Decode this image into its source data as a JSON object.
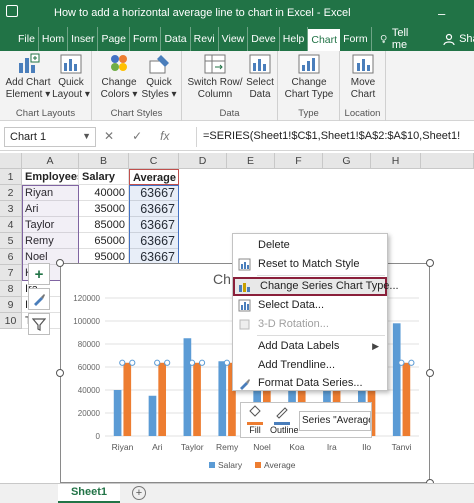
{
  "window": {
    "title": "How to add a horizontal average line to chart in Excel  -  Excel",
    "minimize_glyph": "–"
  },
  "tabs": [
    {
      "label": "File"
    },
    {
      "label": "Hom"
    },
    {
      "label": "Inser"
    },
    {
      "label": "Page"
    },
    {
      "label": "Form"
    },
    {
      "label": "Data"
    },
    {
      "label": "Revi"
    },
    {
      "label": "View"
    },
    {
      "label": "Deve"
    },
    {
      "label": "Help"
    },
    {
      "label": "Chart"
    },
    {
      "label": "Form"
    }
  ],
  "tell_me": "Tell me",
  "share": "Share",
  "ribbon": {
    "groups": {
      "chart_layouts": "Chart Layouts",
      "chart_styles": "Chart Styles",
      "data": "Data",
      "type": "Type",
      "location": "Location"
    },
    "buttons": {
      "add_chart_element_1": "Add Chart",
      "add_chart_element_2": "Element ▾",
      "quick_layout_1": "Quick",
      "quick_layout_2": "Layout ▾",
      "change_colors_1": "Change",
      "change_colors_2": "Colors ▾",
      "quick_styles_1": "Quick",
      "quick_styles_2": "Styles ▾",
      "switch_rowcol_1": "Switch Row/",
      "switch_rowcol_2": "Column",
      "select_data_1": "Select",
      "select_data_2": "Data",
      "change_type_1": "Change",
      "change_type_2": "Chart Type",
      "move_chart_1": "Move",
      "move_chart_2": "Chart"
    }
  },
  "name_box": "Chart 1",
  "formula": "=SERIES(Sheet1!$C$1,Sheet1!$A$2:$A$10,Sheet1!",
  "formula_buttons": {
    "cancel": "✕",
    "enter": "✓",
    "fx": "fx"
  },
  "columns": [
    "A",
    "B",
    "C",
    "D",
    "E",
    "F",
    "G",
    "H"
  ],
  "rows": [
    "1",
    "2",
    "3",
    "4",
    "5",
    "6",
    "7",
    "8",
    "9",
    "10"
  ],
  "table": {
    "headers": [
      "Employees",
      "Salary",
      "Average"
    ],
    "data": [
      [
        "Riyan",
        "40000",
        "63667"
      ],
      [
        "Ari",
        "35000",
        "63667"
      ],
      [
        "Taylor",
        "85000",
        "63667"
      ],
      [
        "Remy",
        "65000",
        "63667"
      ],
      [
        "Noel",
        "95000",
        "63667"
      ],
      [
        "K",
        "",
        ""
      ],
      [
        "Ira",
        "",
        ""
      ],
      [
        "Ilo",
        "",
        ""
      ],
      [
        "Tanvi",
        "",
        ""
      ]
    ]
  },
  "chart_data": {
    "type": "bar",
    "title": "Ch",
    "categories": [
      "Riyan",
      "Ari",
      "Taylor",
      "Remy",
      "Noel",
      "Koa",
      "Ira",
      "Ilo",
      "Tanvi"
    ],
    "category_labels_visible": [
      "Riyan",
      "Ari",
      "Taylor",
      "Remy",
      "Noel",
      "Koa",
      "Ira",
      "Ilo",
      "Tanvi"
    ],
    "series": [
      {
        "name": "Salary",
        "color": "#5B9BD5",
        "values": [
          40000,
          35000,
          85000,
          65000,
          95000,
          75000,
          50000,
          60000,
          98000
        ]
      },
      {
        "name": "Average",
        "color": "#ED7D31",
        "values": [
          63667,
          63667,
          63667,
          63667,
          63667,
          63667,
          63667,
          63667,
          63667
        ]
      }
    ],
    "ylim": [
      0,
      120000
    ],
    "yticks": [
      "0",
      "20000",
      "40000",
      "60000",
      "80000",
      "100000",
      "120000"
    ],
    "legend": "bottom",
    "grid": true
  },
  "context_menu": {
    "items": [
      {
        "label": "Delete",
        "icon": "none",
        "disabled": false
      },
      {
        "label": "Reset to Match Style",
        "icon": "reset-icon",
        "disabled": false
      },
      {
        "label": "Change Series Chart Type...",
        "icon": "chart-type-icon",
        "disabled": false,
        "highlighted": true
      },
      {
        "label": "Select Data...",
        "icon": "select-data-icon",
        "disabled": false
      },
      {
        "label": "3-D Rotation...",
        "icon": "rotation-icon",
        "disabled": true
      },
      {
        "label": "Add Data Labels",
        "icon": "none",
        "disabled": false,
        "submenu": true
      },
      {
        "label": "Add Trendline...",
        "icon": "none",
        "disabled": false
      },
      {
        "label": "Format Data Series...",
        "icon": "format-icon",
        "disabled": false
      }
    ]
  },
  "mini_toolbar": {
    "fill_label": "Fill",
    "outline_label": "Outline",
    "series_select": "Series \"Average\""
  },
  "sheet_tab": "Sheet1",
  "colors": {
    "excel_green": "#217346",
    "salary": "#5B9BD5",
    "average": "#ED7D31",
    "highlight_border": "#8A1F3A"
  }
}
